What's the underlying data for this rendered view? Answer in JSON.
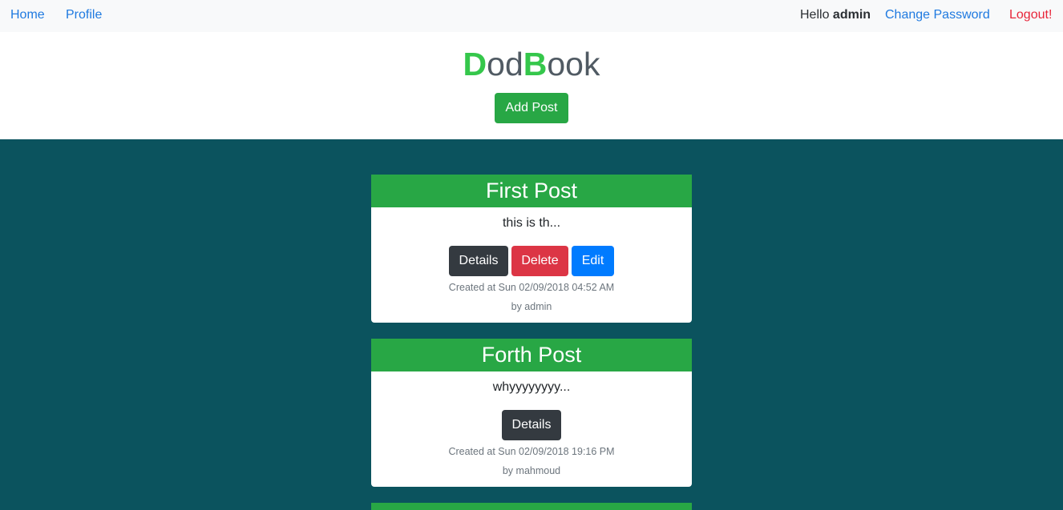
{
  "nav": {
    "home": "Home",
    "profile": "Profile",
    "hello_prefix": "Hello",
    "username": "admin",
    "change_password": "Change Password",
    "logout": "Logout!"
  },
  "header": {
    "logo_d": "D",
    "logo_od": "od",
    "logo_b": "B",
    "logo_ook": "ook",
    "add_post": "Add Post"
  },
  "posts": [
    {
      "title": "First Post",
      "excerpt": "this is th...",
      "buttons": [
        "Details",
        "Delete",
        "Edit"
      ],
      "created": "Created at Sun 02/09/2018 04:52 AM",
      "author": "by admin"
    },
    {
      "title": "Forth Post",
      "excerpt": "whyyyyyyyy...",
      "buttons": [
        "Details"
      ],
      "created": "Created at Sun 02/09/2018 19:16 PM",
      "author": "by mahmoud"
    }
  ],
  "colors": {
    "accent_green": "#28a745",
    "logo_green": "#35c74b",
    "main_background": "#0b535e",
    "link_blue": "#1f7ae0",
    "logout_red": "#e8253a"
  }
}
